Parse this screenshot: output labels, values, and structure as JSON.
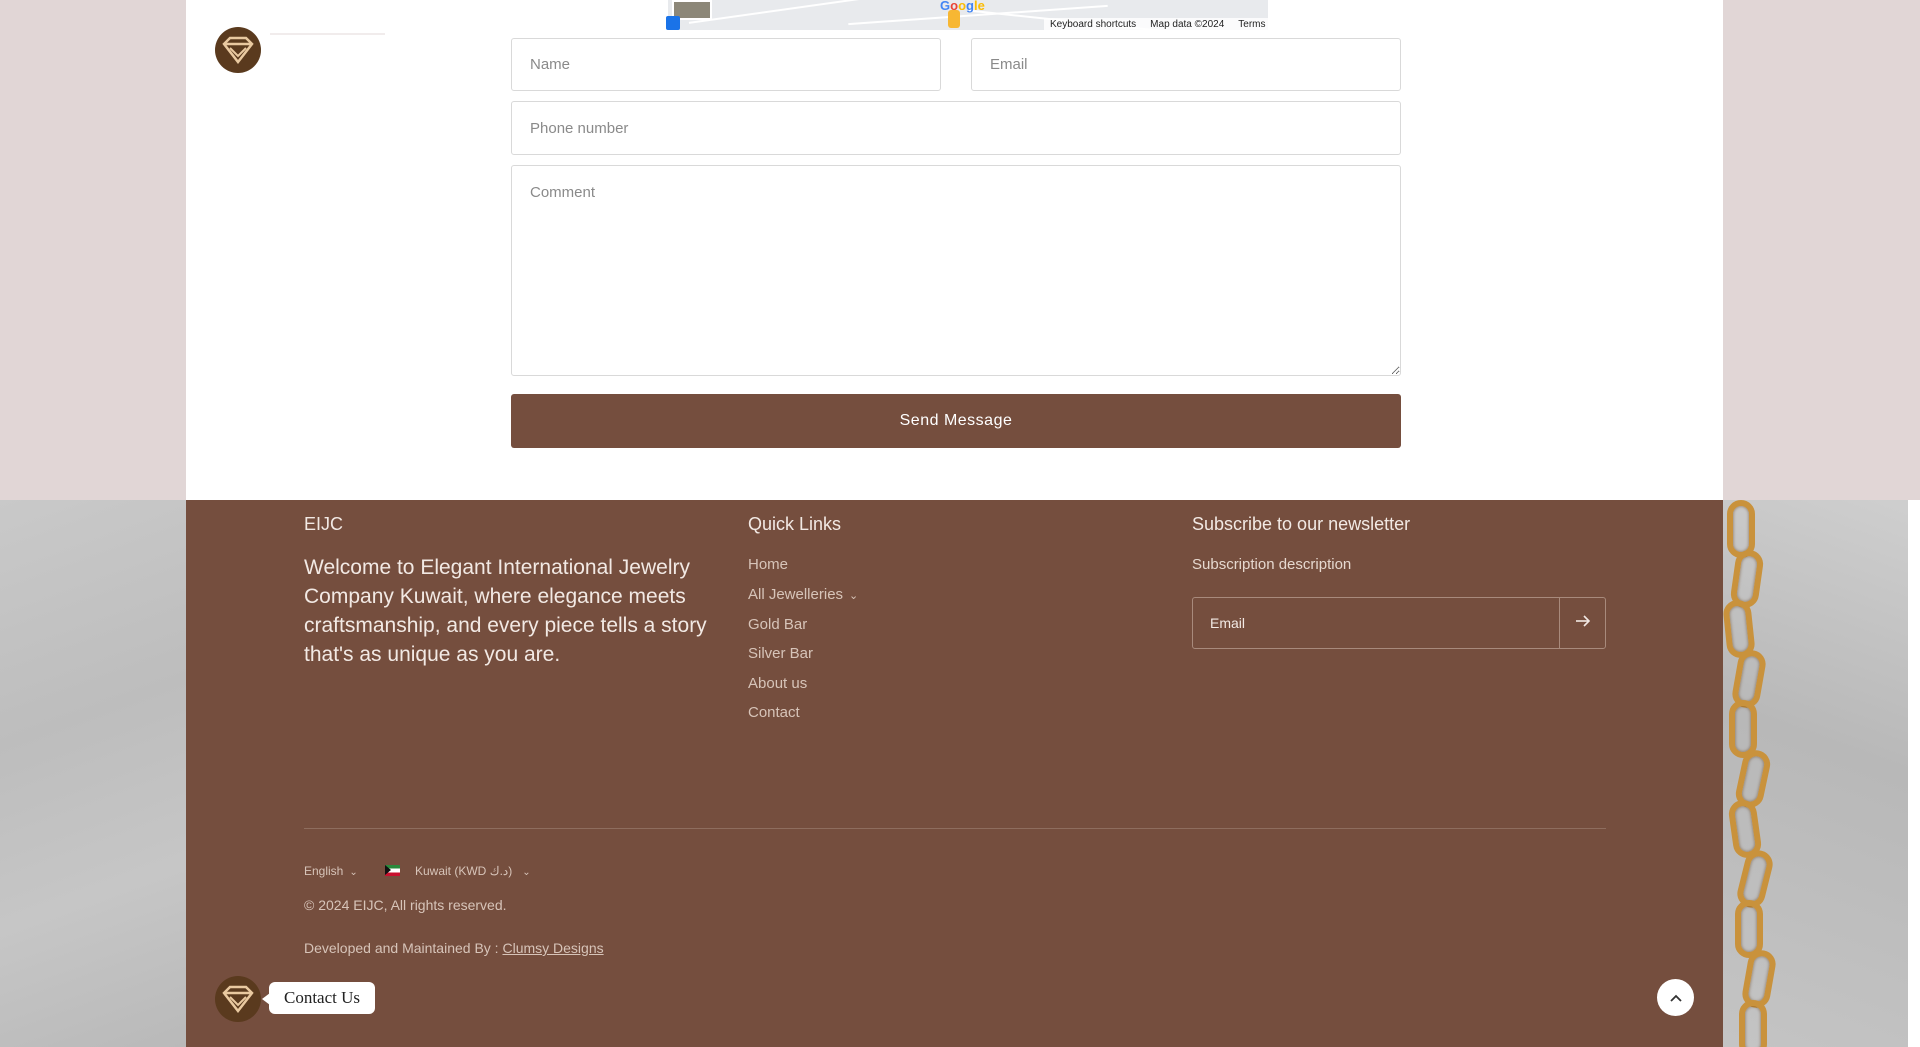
{
  "map": {
    "keyboard_shortcuts": "Keyboard shortcuts",
    "map_data": "Map data ©2024",
    "terms": "Terms"
  },
  "contact_form": {
    "name_placeholder": "Name",
    "email_placeholder": "Email",
    "phone_placeholder": "Phone number",
    "comment_placeholder": "Comment",
    "send_label": "Send Message"
  },
  "footer": {
    "brand": "EIJC",
    "welcome": "Welcome to Elegant International Jewelry Company Kuwait, where elegance meets craftsmanship, and every piece tells a story that's as unique as you are.",
    "quick_links": {
      "heading": "Quick Links",
      "items": [
        "Home",
        "All Jewelleries",
        "Gold Bar",
        "Silver Bar",
        "About us",
        "Contact"
      ]
    },
    "newsletter": {
      "heading": "Subscribe to our newsletter",
      "description": "Subscription description",
      "email_placeholder": "Email"
    },
    "language": "English",
    "country": "Kuwait (KWD د.ك)",
    "copyright": "© 2024 EIJC, All rights reserved.",
    "developed_prefix": "Developed and Maintained By : ",
    "developer": "Clumsy Designs"
  },
  "chat_widget": {
    "label": "Contact Us"
  },
  "icons": {
    "logo": "diamond-logo-icon",
    "newsletter_submit": "arrow-right-icon",
    "scroll_top": "chevron-up-icon",
    "dropdown": "chevron-down-icon"
  },
  "colors": {
    "brand_brown": "#754e3e",
    "logo_brown": "#5a3a1e",
    "page_bg": "#e1d6d6"
  }
}
